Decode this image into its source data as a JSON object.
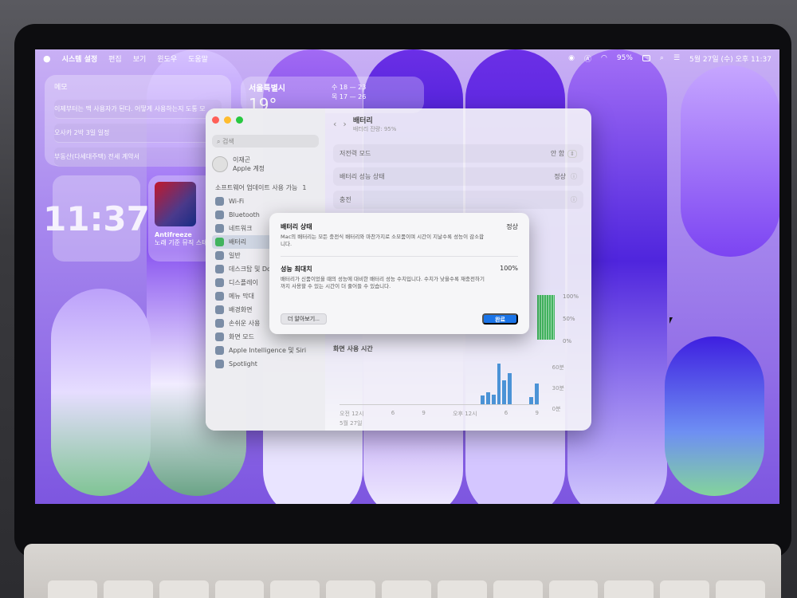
{
  "menubar": {
    "apple": "",
    "app": "시스템 설정",
    "menus": [
      "편집",
      "보기",
      "윈도우",
      "도움말"
    ],
    "battery": "95%",
    "clock": "5월 27일 (수) 오후 11:37"
  },
  "widgets": {
    "memo_title": "메모",
    "memo_rows": [
      "이제부터는 맥 사용자가 된다. 어떻게 사용하는지 도통 모",
      "오사카 2박 3일 일정",
      "부동산(다세대주택) 전세 계약서"
    ],
    "weather_city": "서울특별시",
    "weather_temp": "19°",
    "weather_rows": [
      "수  18 — 23",
      "목  17 — 26"
    ],
    "clock": "11:37",
    "music_title": "Antifreeze",
    "music_sub": "노래 기준 뮤직 스테"
  },
  "sidebar": {
    "search": "검색",
    "account_name": "이재곤",
    "account_sub": "Apple 계정",
    "update": "소프트웨어 업데이트 사용 가능",
    "update_badge": "1",
    "items": [
      {
        "label": "Wi-Fi"
      },
      {
        "label": "Bluetooth"
      },
      {
        "label": "네트워크"
      },
      {
        "label": "배터리"
      },
      {
        "label": "일반"
      },
      {
        "label": "데스크탑 및 Dock"
      },
      {
        "label": "디스플레이"
      },
      {
        "label": "메뉴 막대"
      },
      {
        "label": "배경화면"
      },
      {
        "label": "손쉬운 사용"
      },
      {
        "label": "화면 모드"
      },
      {
        "label": "Apple Intelligence 및 Siri"
      },
      {
        "label": "Spotlight"
      }
    ]
  },
  "main": {
    "title": "배터리",
    "subtitle": "배터리 잔량: 95%",
    "low_power_label": "저전력 모드",
    "low_power_value": "안 함",
    "health_label": "배터리 성능 상태",
    "health_value": "정상",
    "charging_label": "충전",
    "pct_labels": [
      "100%",
      "50%",
      "0%"
    ],
    "screen_time_title": "화면 사용 시간",
    "y_labels": [
      "60분",
      "30분",
      "0분"
    ],
    "x_labels": [
      "오전 12시",
      "6",
      "9",
      "오후 12시",
      "6",
      "9"
    ],
    "date": "5월 27일"
  },
  "modal": {
    "row1_title": "배터리 상태",
    "row1_value": "정상",
    "row1_desc": "Mac의 배터리는 모든 충전식 배터리와 마찬가지로 소모품이며 시간이 지날수록 성능이 감소합니다.",
    "row2_title": "성능 최대치",
    "row2_value": "100%",
    "row2_desc": "배터리가 신품이었을 때의 성능에 대비한 배터리 성능 수치입니다. 수치가 낮을수록 재충전하기까지 사용할 수 있는 시간이 더 줄어들 수 있습니다.",
    "learn_more": "더 알아보기...",
    "done": "완료"
  },
  "colors": {
    "accent": "#1a74e8",
    "battery_green": "#41b35e",
    "chart_blue": "#4b93d6"
  },
  "screen_time_bars": [
    0,
    0,
    0,
    0,
    0,
    0,
    0,
    0,
    0,
    0,
    0,
    0,
    0,
    0,
    0,
    0,
    0,
    0,
    0,
    0,
    0,
    0,
    0,
    0,
    0,
    0,
    12,
    16,
    13,
    55,
    32,
    42,
    0,
    0,
    0,
    10,
    28
  ]
}
